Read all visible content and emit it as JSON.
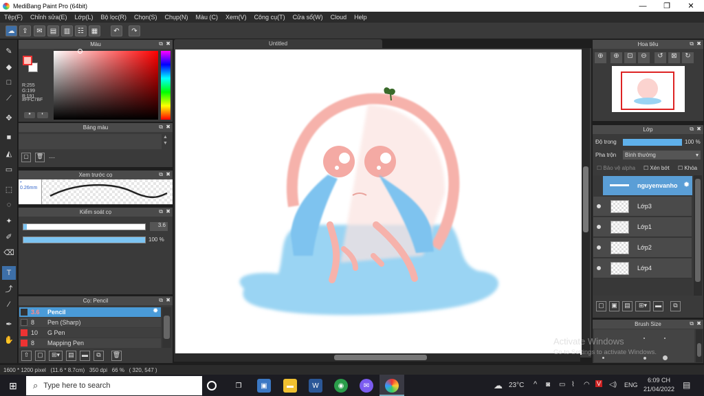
{
  "title": "MediBang Paint Pro (64bit)",
  "menu": [
    "Tệp(F)",
    "Chỉnh sửa(E)",
    "Lớp(L)",
    "Bộ lọc(R)",
    "Chọn(S)",
    "Chụp(N)",
    "Màu (C)",
    "Xem(V)",
    "Công cụ(T)",
    "Cửa sổ(W)",
    "Cloud",
    "Help"
  ],
  "color_panel": {
    "title": "Màu",
    "r": "R:255",
    "g": "G:199",
    "b": "B:191",
    "hex": "#FFC7BF",
    "fg": "#ffc7bf"
  },
  "palette_panel": {
    "title": "Bảng màu",
    "dash": "---"
  },
  "brush_preview": {
    "title": "Xem trước cọ",
    "size": "0.26mm"
  },
  "brush_control": {
    "title": "Kiểm soát cọ",
    "size_value": "3.6",
    "opacity_value": "100 %",
    "size_fraction": 0.03,
    "opacity_fraction": 1.0
  },
  "brush_panel": {
    "title": "Cọ: Pencil",
    "items": [
      {
        "size": "3.6",
        "name": "Pencil",
        "selected": true
      },
      {
        "size": "8",
        "name": "Pen (Sharp)",
        "selected": false
      },
      {
        "size": "10",
        "name": "G Pen",
        "selected": false
      },
      {
        "size": "8",
        "name": "Mapping Pen",
        "selected": false
      }
    ]
  },
  "canvas": {
    "tab": "Untitled"
  },
  "navigator": {
    "title": "Hoa tiêu"
  },
  "layer_panel": {
    "title": "Lớp",
    "opacity_label": "Độ trong",
    "opacity_value": "100 %",
    "opacity_fraction": 1.0,
    "blend_label": "Pha trộn",
    "blend_value": "Bình thường",
    "protect_alpha": "Bảo vệ alpha",
    "clip": "Xén bớt",
    "lock": "Khóa",
    "layers": [
      {
        "name": "nguyenvanho",
        "selected": true
      },
      {
        "name": "Lớp3",
        "selected": false
      },
      {
        "name": "Lớp1",
        "selected": false
      },
      {
        "name": "Lớp2",
        "selected": false
      },
      {
        "name": "Lớp4",
        "selected": false
      }
    ]
  },
  "brush_size_panel": {
    "title": "Brush Size"
  },
  "status": {
    "text": "1600 * 1200 pixel   (11.6 * 8.7cm)   350 dpi   66 %   ( 320, 547 )"
  },
  "watermark": {
    "line1": "Activate Windows",
    "line2": "Go to Settings to activate Windows."
  },
  "taskbar": {
    "search_placeholder": "Type here to search",
    "weather": "23°C",
    "lang": "ENG",
    "time": "6:09 CH",
    "date": "21/04/2022"
  }
}
